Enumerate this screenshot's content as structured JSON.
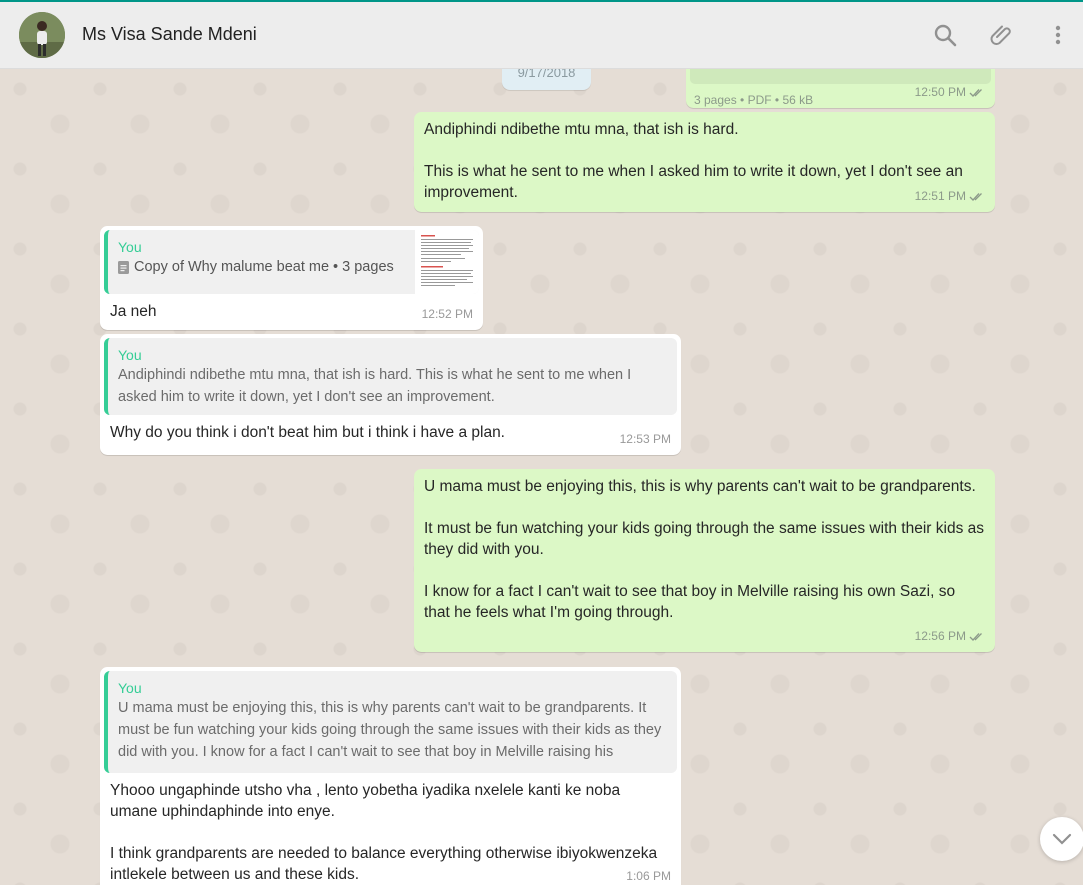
{
  "header": {
    "contact_name": "Ms Visa Sande Mdeni",
    "icons": [
      "search-icon",
      "attach-icon",
      "menu-icon"
    ]
  },
  "date_divider": "9/17/2018",
  "messages": {
    "m1": {
      "meta": "3 pages • PDF • 56 kB",
      "time": "12:50 PM"
    },
    "m2": {
      "line1": "Andiphindi ndibethe mtu mna, that ish is hard.",
      "line2": "This is what he sent to me when I asked him to write it down, yet I don't see an improvement.",
      "time": "12:51 PM"
    },
    "m3": {
      "quote_author": "You",
      "quote_doc": "Copy of Why malume beat me • 3 pages",
      "text": "Ja neh",
      "time": "12:52 PM"
    },
    "m4": {
      "quote_author": "You",
      "quote_text": "Andiphindi ndibethe mtu mna, that ish is hard. This is what he sent to me when I asked him to write it down, yet I don't see an improvement.",
      "text": "Why do you think i don't beat him but i think i have a plan.",
      "time": "12:53 PM"
    },
    "m5": {
      "line1": "U mama must be enjoying this, this is why parents can't wait to be grandparents.",
      "line2": "It must be fun watching your kids going through the same issues with their kids as they did with you.",
      "line3": "I know for a fact I can't wait to see that boy in Melville raising his own Sazi, so that he feels what I'm going through.",
      "time": "12:56 PM"
    },
    "m6": {
      "quote_author": "You",
      "quote_text": "U mama must be enjoying this, this is why parents can't wait to be grandparents. It must be fun watching your kids going through the same issues with their kids as they did with you. I know for a fact I can't wait to see that boy in Melville raising his",
      "line1": "Yhooo ungaphinde utsho vha , lento yobetha iyadika nxelele kanti ke noba umane uphindaphinde into enye.",
      "line2": "I think grandparents are needed to balance everything otherwise ibiyokwenzeka intlekele between us and these kids.",
      "time": "1:06 PM"
    }
  },
  "colors": {
    "outgoing_bubble": "#dcf8c6",
    "incoming_bubble": "#ffffff",
    "quote_accent": "#35cd96",
    "read_ticks": "#8c9a8a"
  }
}
